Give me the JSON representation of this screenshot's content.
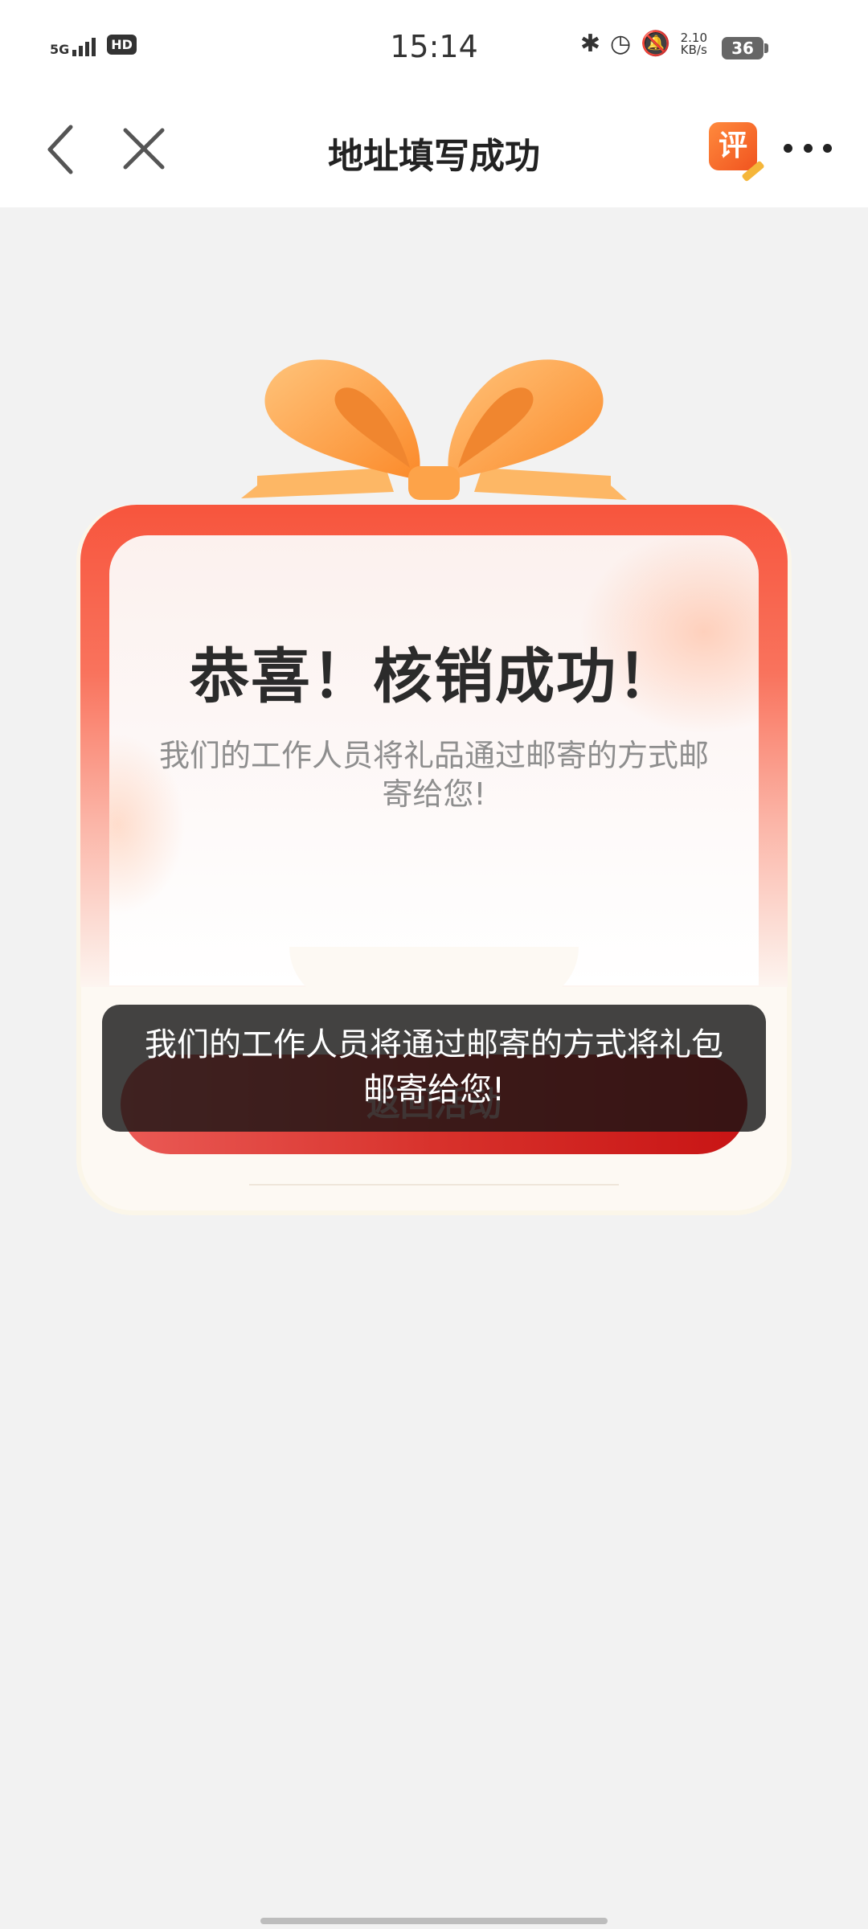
{
  "status_bar": {
    "network": "5G",
    "hd_badge": "HD",
    "time": "15:14",
    "net_speed_value": "2.10",
    "net_speed_unit": "KB/s",
    "battery_level": "36"
  },
  "nav": {
    "title": "地址填写成功",
    "review_label": "评"
  },
  "card": {
    "title": "恭喜！核销成功！",
    "description": "我们的工作人员将礼品通过邮寄的方式邮寄给您!",
    "button_label": "返回活动"
  },
  "toast": {
    "message": "我们的工作人员将通过邮寄的方式将礼包邮寄给您!"
  },
  "colors": {
    "frame_red": "#f7553d",
    "button_red": "#d8322c",
    "ribbon_orange": "#fb9a3c"
  }
}
